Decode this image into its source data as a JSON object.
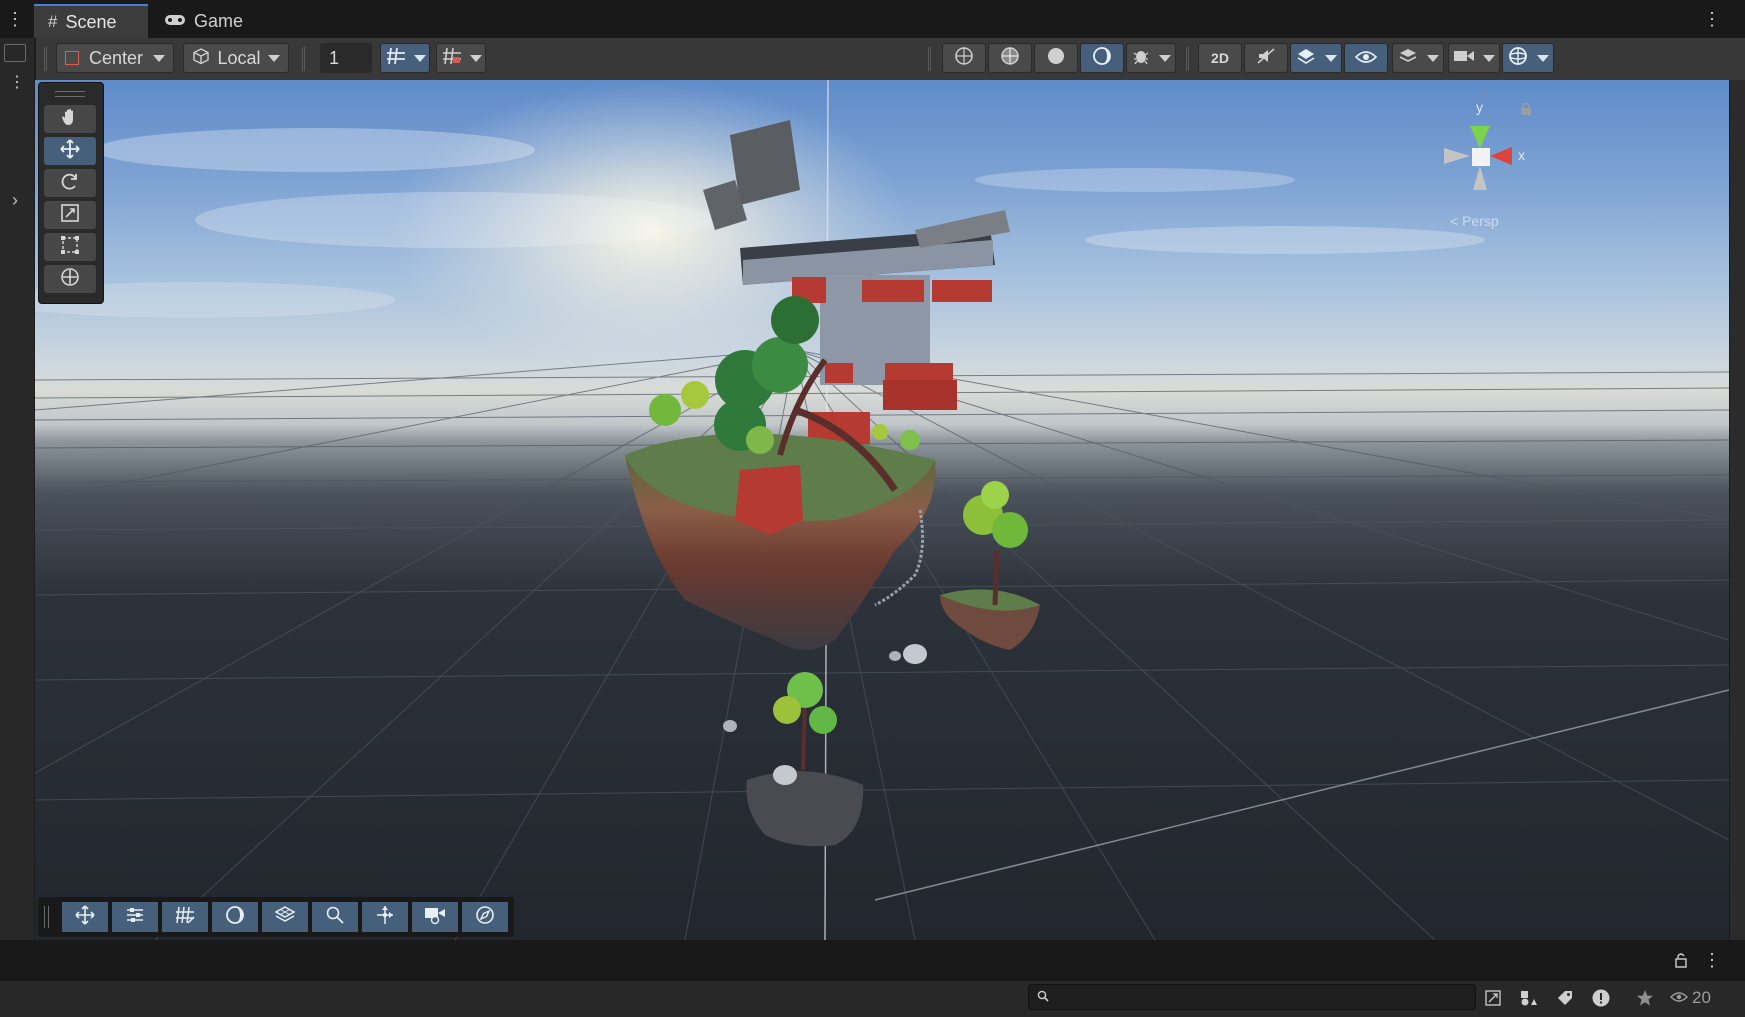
{
  "tabs": [
    {
      "label": "Scene",
      "icon": "grid-icon",
      "active": true
    },
    {
      "label": "Game",
      "icon": "gamepad-icon",
      "active": false
    }
  ],
  "toolbar": {
    "pivot_label": "Center",
    "space_label": "Local",
    "grid_snap_value": "1"
  },
  "gizmo": {
    "y_label": "y",
    "x_label": "x",
    "projection_label": "< Persp"
  },
  "status": {
    "search_placeholder": "",
    "visibility_count": "20"
  },
  "colors": {
    "accent_blue": "#46607c",
    "tab_highlight": "#4c7fd6",
    "panel_dark": "#191919",
    "toolbar_bg": "#383838",
    "axis_y": "#7bd44a",
    "axis_x": "#e0433a"
  }
}
